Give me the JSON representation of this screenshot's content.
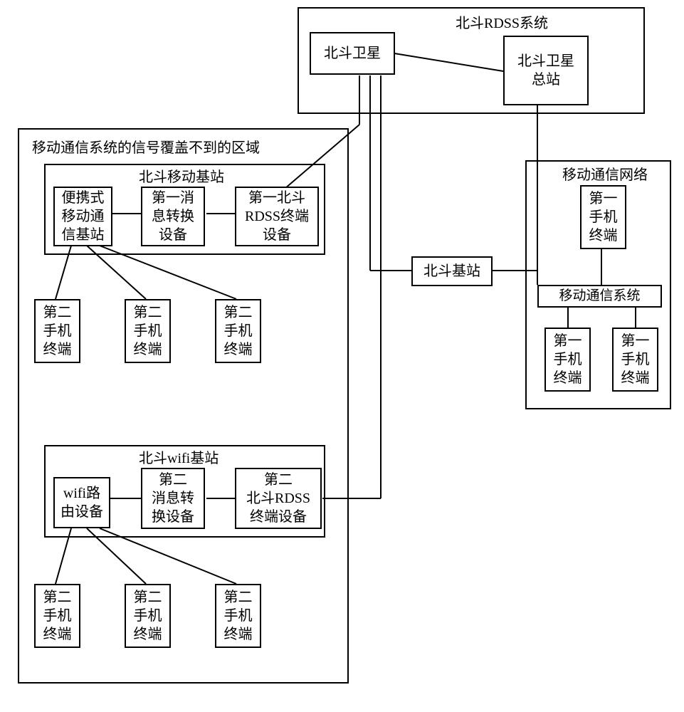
{
  "rdss_system": {
    "title": "北斗RDSS系统",
    "satellite": "北斗卫星",
    "master_station": "北斗卫星\n总站"
  },
  "no_coverage_area": {
    "title": "移动通信系统的信号覆盖不到的区域",
    "mobile_base": {
      "title": "北斗移动基站",
      "portable_station": "便携式\n移动通\n信基站",
      "msg_converter": "第一消\n息转换\n设备",
      "rdss_terminal": "第一北斗\nRDSS终端\n设备"
    },
    "wifi_base": {
      "title": "北斗wifi基站",
      "wifi_router": "wifi路\n由设备",
      "msg_converter": "第二\n消息转\n换设备",
      "rdss_terminal": "第二\n北斗RDSS\n终端设备"
    },
    "second_phone": "第二\n手机\n终端"
  },
  "beidou_base": "北斗基站",
  "mobile_network": {
    "title": "移动通信网络",
    "first_phone": "第一\n手机\n终端",
    "mobile_system": "移动通信系统"
  }
}
